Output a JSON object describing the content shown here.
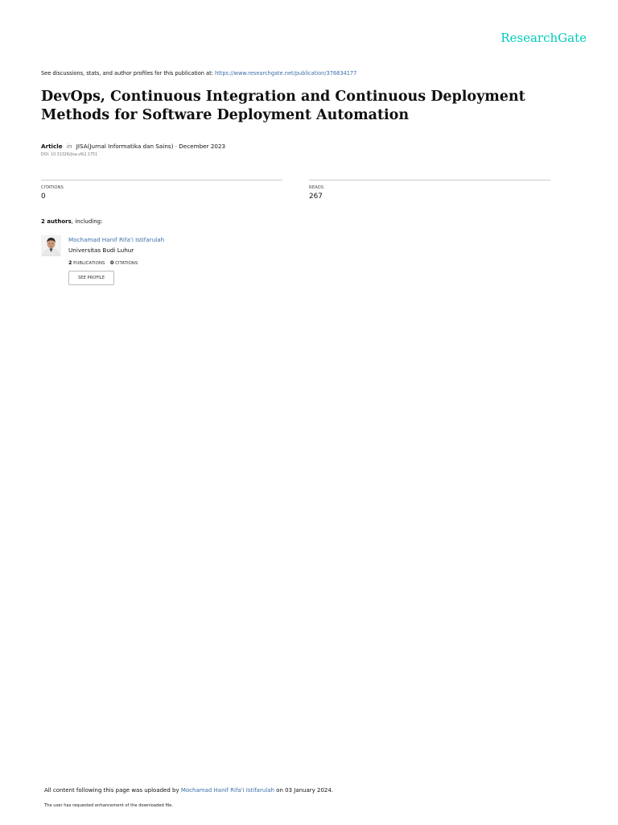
{
  "brand": {
    "logo_text": "ResearchGate",
    "accent_color": "#00ccbb"
  },
  "header": {
    "discuss_text": "See discussions, stats, and author profiles for this publication at: ",
    "publication_url": "https://www.researchgate.net/publication/376834177"
  },
  "publication": {
    "title": "DevOps, Continuous Integration and Continuous Deployment Methods for Software Deployment Automation",
    "type": "Article",
    "in_label": "in",
    "venue_date": "JISA(Jurnal Informatika dan Sains) · December 2023",
    "doi": "DOI: 10.31326/jisa.v6i2.1751"
  },
  "stats": {
    "citations_label": "CITATIONS",
    "citations_value": "0",
    "reads_label": "READS",
    "reads_value": "267"
  },
  "authors": {
    "count_text": "2 authors",
    "including_text": ", including:",
    "list": [
      {
        "name": "Mochamad Hanif Rifa'i Istifarulah",
        "institution": "Universitas Budi Luhur",
        "publications_count": "2",
        "publications_label": "PUBLICATIONS",
        "citations_count": "0",
        "citations_label": "CITATIONS",
        "profile_button": "SEE PROFILE",
        "avatar_icon": "author-avatar"
      }
    ]
  },
  "footer": {
    "upload_prefix": "All content following this page was uploaded by ",
    "uploader": "Mochamad Hanif Rifa'i Istifarulah",
    "upload_suffix": " on 03 January 2024.",
    "enhancement_note": "The user has requested enhancement of the downloaded file."
  },
  "colors": {
    "link": "#3b6fa8",
    "rule": "#cccccc"
  }
}
